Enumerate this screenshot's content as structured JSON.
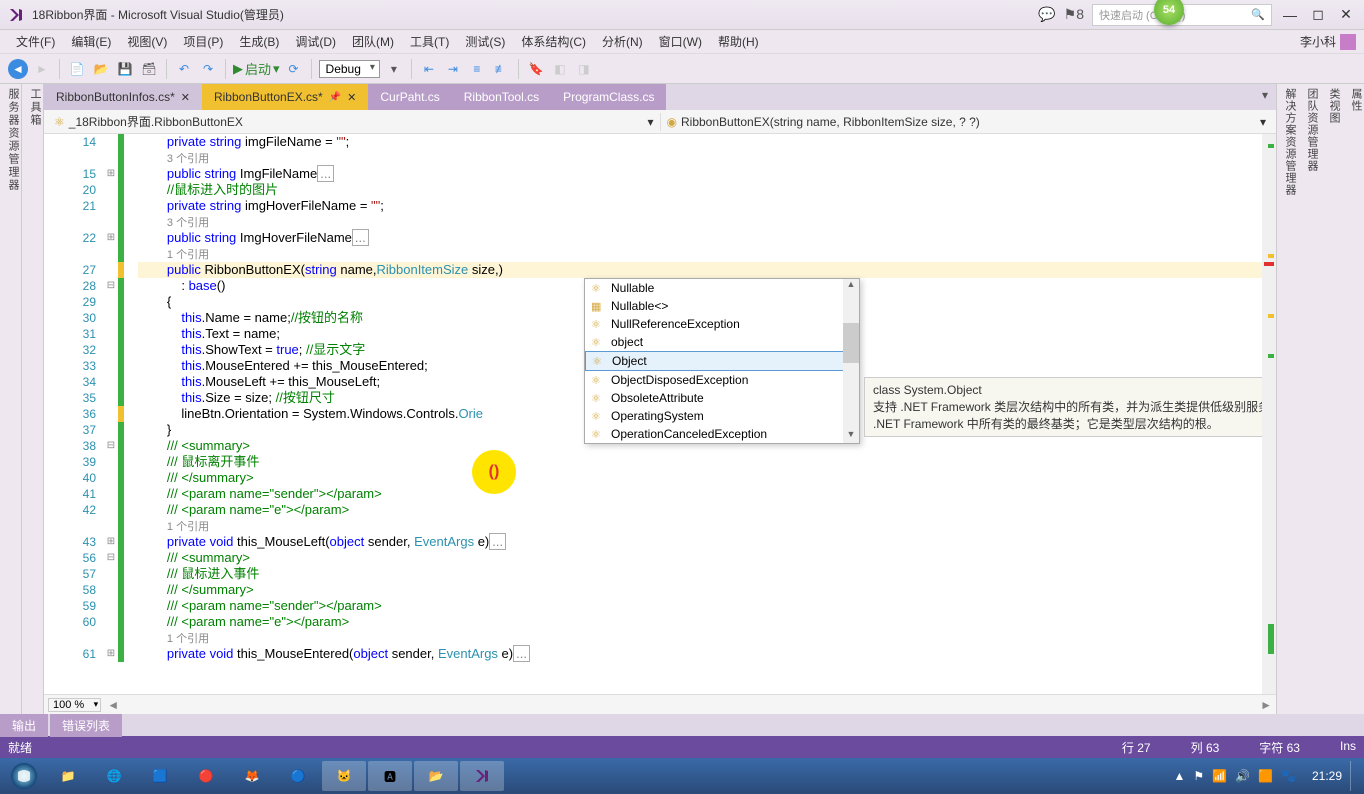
{
  "titlebar": {
    "title": "18Ribbon界面 - Microsoft Visual Studio(管理员)",
    "notif_count": "8",
    "quick_launch": "快速启动 (Ctrl+Q)",
    "badge": "54"
  },
  "menubar": {
    "items": [
      "文件(F)",
      "编辑(E)",
      "视图(V)",
      "项目(P)",
      "生成(B)",
      "调试(D)",
      "团队(M)",
      "工具(T)",
      "测试(S)",
      "体系结构(C)",
      "分析(N)",
      "窗口(W)",
      "帮助(H)"
    ],
    "user": "李小科"
  },
  "toolbar": {
    "start": "启动",
    "config": "Debug"
  },
  "doctabs": [
    {
      "label": "RibbonButtonInfos.cs*",
      "kind": "inactive"
    },
    {
      "label": "RibbonButtonEX.cs*",
      "kind": "active"
    },
    {
      "label": "CurPaht.cs",
      "kind": "bg"
    },
    {
      "label": "RibbonTool.cs",
      "kind": "bg"
    },
    {
      "label": "ProgramClass.cs",
      "kind": "bg"
    }
  ],
  "nav": {
    "left_icon": "⚛",
    "left": "_18Ribbon界面.RibbonButtonEX",
    "right_icon": "◉",
    "right": "RibbonButtonEX(string name, RibbonItemSize size, ? ?)"
  },
  "intellisense": {
    "items": [
      {
        "icon": "⚛",
        "label": "Nullable"
      },
      {
        "icon": "▦",
        "label": "Nullable<>"
      },
      {
        "icon": "⚛",
        "label": "NullReferenceException"
      },
      {
        "icon": "⚛",
        "label": "object"
      },
      {
        "icon": "⚛",
        "label": "Object",
        "selected": true
      },
      {
        "icon": "⚛",
        "label": "ObjectDisposedException"
      },
      {
        "icon": "⚛",
        "label": "ObsoleteAttribute"
      },
      {
        "icon": "⚛",
        "label": "OperatingSystem"
      },
      {
        "icon": "⚛",
        "label": "OperationCanceledException"
      }
    ]
  },
  "tooltip": {
    "title": "class System.Object",
    "desc": "支持 .NET Framework 类层次结构中的所有类，并为派生类提供低级别服务。这是 .NET Framework 中所有类的最终基类；它是类型层次结构的根。"
  },
  "code": {
    "lines": [
      {
        "n": "14",
        "bar": "g",
        "html": "        <span class='kw'>private</span> <span class='kw'>string</span> imgFileName = <span class='str'>\"\"</span>;"
      },
      {
        "n": "",
        "bar": "g",
        "html": "        <span class='ref'>3 个引用</span>"
      },
      {
        "n": "15",
        "bar": "g",
        "fold": "⊞",
        "html": "        <span class='kw'>public</span> <span class='kw'>string</span> ImgFileName<span style='border:1px solid #aaa;padding:0 2px;color:#888'>...</span>"
      },
      {
        "n": "20",
        "bar": "g",
        "html": "        <span class='com'>//鼠标进入时的图片</span>"
      },
      {
        "n": "21",
        "bar": "g",
        "html": "        <span class='kw'>private</span> <span class='kw'>string</span> imgHoverFileName = <span class='str'>\"\"</span>;"
      },
      {
        "n": "",
        "bar": "g",
        "html": "        <span class='ref'>3 个引用</span>"
      },
      {
        "n": "22",
        "bar": "g",
        "fold": "⊞",
        "html": "        <span class='kw'>public</span> <span class='kw'>string</span> ImgHoverFileName<span style='border:1px solid #aaa;padding:0 2px;color:#888'>...</span>"
      },
      {
        "n": "",
        "bar": "g",
        "html": "        <span class='ref'>1 个引用</span>"
      },
      {
        "n": "27",
        "bar": "y",
        "hl": true,
        "html": "        <span class='kw'>public</span> RibbonButtonEX(<span class='kw'>string</span> name,<span class='typ'>RibbonItemSize</span> size,)"
      },
      {
        "n": "28",
        "bar": "g",
        "fold": "⊟",
        "html": "            : <span class='kw'>base</span>()"
      },
      {
        "n": "29",
        "bar": "g",
        "html": "        {"
      },
      {
        "n": "30",
        "bar": "g",
        "html": "            <span class='kw'>this</span>.Name = name;<span class='com'>//按钮的名称</span>"
      },
      {
        "n": "31",
        "bar": "g",
        "html": "            <span class='kw'>this</span>.Text = name;"
      },
      {
        "n": "32",
        "bar": "g",
        "html": "            <span class='kw'>this</span>.ShowText = <span class='kw'>true</span>; <span class='com'>//显示文字</span>"
      },
      {
        "n": "33",
        "bar": "g",
        "html": "            <span class='kw'>this</span>.MouseEntered += this_MouseEntered;"
      },
      {
        "n": "34",
        "bar": "g",
        "html": "            <span class='kw'>this</span>.MouseLeft += this_MouseLeft;"
      },
      {
        "n": "35",
        "bar": "g",
        "html": "            <span class='kw'>this</span>.Size = size; <span class='com'>//按钮尺寸</span>"
      },
      {
        "n": "36",
        "bar": "y",
        "html": "            lineBtn.Orientation = System.Windows.Controls.<span class='typ'>Orie</span>"
      },
      {
        "n": "37",
        "bar": "g",
        "html": "        }"
      },
      {
        "n": "38",
        "bar": "g",
        "fold": "⊟",
        "html": "        <span class='com'>/// &lt;summary&gt;</span>"
      },
      {
        "n": "39",
        "bar": "g",
        "html": "        <span class='com'>/// 鼠标离开事件</span>"
      },
      {
        "n": "40",
        "bar": "g",
        "html": "        <span class='com'>/// &lt;/summary&gt;</span>"
      },
      {
        "n": "41",
        "bar": "g",
        "html": "        <span class='com'>/// &lt;param name=\"sender\"&gt;&lt;/param&gt;</span>"
      },
      {
        "n": "42",
        "bar": "g",
        "html": "        <span class='com'>/// &lt;param name=\"e\"&gt;&lt;/param&gt;</span>"
      },
      {
        "n": "",
        "bar": "g",
        "html": "        <span class='ref'>1 个引用</span>"
      },
      {
        "n": "43",
        "bar": "g",
        "fold": "⊞",
        "html": "        <span class='kw'>private</span> <span class='kw'>void</span> this_MouseLeft(<span class='kw'>object</span> sender, <span class='typ'>EventArgs</span> e)<span style='border:1px solid #aaa;padding:0 2px;color:#888'>...</span>"
      },
      {
        "n": "56",
        "bar": "g",
        "fold": "⊟",
        "html": "        <span class='com'>/// &lt;summary&gt;</span>"
      },
      {
        "n": "57",
        "bar": "g",
        "html": "        <span class='com'>/// 鼠标进入事件</span>"
      },
      {
        "n": "58",
        "bar": "g",
        "html": "        <span class='com'>/// &lt;/summary&gt;</span>"
      },
      {
        "n": "59",
        "bar": "g",
        "html": "        <span class='com'>/// &lt;param name=\"sender\"&gt;&lt;/param&gt;</span>"
      },
      {
        "n": "60",
        "bar": "g",
        "html": "        <span class='com'>/// &lt;param name=\"e\"&gt;&lt;/param&gt;</span>"
      },
      {
        "n": "",
        "bar": "g",
        "html": "        <span class='ref'>1 个引用</span>"
      },
      {
        "n": "61",
        "bar": "g",
        "fold": "⊞",
        "html": "        <span class='kw'>private</span> <span class='kw'>void</span> this_MouseEntered(<span class='kw'>object</span> sender, <span class='typ'>EventArgs</span> e)<span style='border:1px solid #aaa;padding:0 2px;color:#888'>...</span>"
      }
    ]
  },
  "zoom": "100 %",
  "bottom_tabs": [
    "输出",
    "错误列表"
  ],
  "sidetabs": {
    "left1": "服务器资源管理器",
    "left2": "工具箱",
    "right1": "解决方案资源管理器",
    "right2": "团队资源管理器",
    "right3": "类视图",
    "right4": "属性"
  },
  "statusbar": {
    "ready": "就绪",
    "line": "行 27",
    "col": "列 63",
    "char": "字符 63",
    "ins": "Ins"
  },
  "taskbar": {
    "clock": "21:29"
  },
  "cursor_ring": "()"
}
